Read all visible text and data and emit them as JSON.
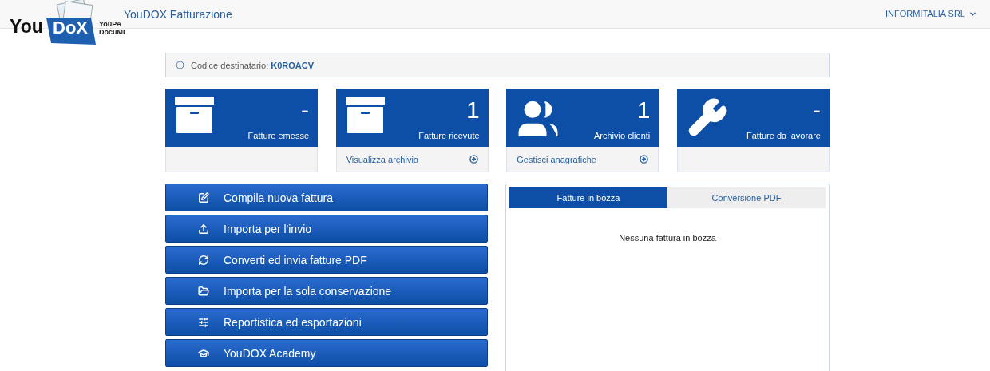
{
  "logo": {
    "word_1": "You",
    "word_2": "DoX",
    "tag_1": "YouPA",
    "tag_2": "DocuMI"
  },
  "header": {
    "title": "YouDOX Fatturazione",
    "account": "INFORMITALIA SRL"
  },
  "info": {
    "label": "Codice destinatario:",
    "code": "K0ROACV"
  },
  "tiles": [
    {
      "kind": "archive",
      "value": "-",
      "label": "Fatture emesse"
    },
    {
      "kind": "archive",
      "value": "1",
      "label": "Fatture ricevute",
      "link": "Visualizza archivio"
    },
    {
      "kind": "users",
      "value": "1",
      "label": "Archivio clienti",
      "link": "Gestisci anagrafiche"
    },
    {
      "kind": "tool",
      "value": "-",
      "label": "Fatture da lavorare"
    }
  ],
  "actions": [
    {
      "kind": "compose",
      "label": "Compila nuova fattura"
    },
    {
      "kind": "upload",
      "label": "Importa per l'invio"
    },
    {
      "kind": "convert",
      "label": "Converti ed invia fatture PDF"
    },
    {
      "kind": "folder",
      "label": "Importa per la sola conservazione"
    },
    {
      "kind": "report",
      "label": "Reportistica ed esportazioni"
    },
    {
      "kind": "academy",
      "label": "YouDOX Academy"
    }
  ],
  "panel": {
    "tabs": [
      {
        "label": "Fatture in bozza",
        "selected": true
      },
      {
        "label": "Conversione PDF",
        "selected": false
      }
    ],
    "empty_message": "Nessuna fattura in bozza"
  }
}
